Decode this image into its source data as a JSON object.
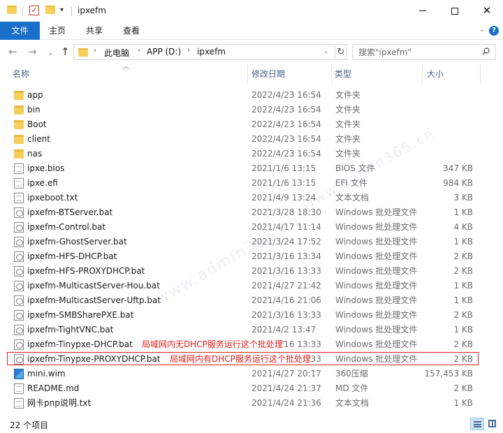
{
  "window": {
    "title": "ipxefm",
    "minimize_icon": "minimize-icon",
    "maximize_icon": "maximize-icon",
    "close_glyph": "✕"
  },
  "ribbon": {
    "tabs": [
      {
        "label": "文件"
      },
      {
        "label": "主页"
      },
      {
        "label": "共享"
      },
      {
        "label": "查看"
      }
    ],
    "accent": "#1a6fc9"
  },
  "navigation": {
    "back_glyph": "←",
    "forward_glyph": "→",
    "recent_glyph": "⌄",
    "up_glyph": "↑",
    "breadcrumbs": [
      "此电脑",
      "APP (D:)",
      "ipxefm"
    ],
    "search_placeholder": "搜索\"ipxefm\""
  },
  "columns": {
    "name": "名称",
    "date": "修改日期",
    "type": "类型",
    "size": "大小"
  },
  "files": [
    {
      "name": "app",
      "date": "2022/4/23 16:54",
      "type": "文件夹",
      "size": "",
      "icon": "folder-icon"
    },
    {
      "name": "bin",
      "date": "2022/4/23 16:54",
      "type": "文件夹",
      "size": "",
      "icon": "folder-icon"
    },
    {
      "name": "Boot",
      "date": "2022/4/23 16:54",
      "type": "文件夹",
      "size": "",
      "icon": "folder-icon"
    },
    {
      "name": "client",
      "date": "2022/4/23 16:54",
      "type": "文件夹",
      "size": "",
      "icon": "folder-icon"
    },
    {
      "name": "nas",
      "date": "2022/4/23 16:54",
      "type": "文件夹",
      "size": "",
      "icon": "folder-icon"
    },
    {
      "name": "ipxe.bios",
      "date": "2021/1/6 13:15",
      "type": "BIOS 文件",
      "size": "347 KB",
      "icon": "file-icon"
    },
    {
      "name": "ipxe.efi",
      "date": "2021/1/6 13:15",
      "type": "EFI 文件",
      "size": "984 KB",
      "icon": "file-icon"
    },
    {
      "name": "ipxeboot.txt",
      "date": "2021/4/9 13:24",
      "type": "文本文档",
      "size": "3 KB",
      "icon": "text-file-icon"
    },
    {
      "name": "ipxefm-BTServer.bat",
      "date": "2021/3/28 18:30",
      "type": "Windows 批处理文件",
      "size": "1 KB",
      "icon": "batch-file-icon"
    },
    {
      "name": "ipxefm-Control.bat",
      "date": "2021/4/17 11:14",
      "type": "Windows 批处理文件",
      "size": "4 KB",
      "icon": "batch-file-icon"
    },
    {
      "name": "ipxefm-GhostServer.bat",
      "date": "2021/3/24 17:52",
      "type": "Windows 批处理文件",
      "size": "1 KB",
      "icon": "batch-file-icon"
    },
    {
      "name": "ipxefm-HFS-DHCP.bat",
      "date": "2021/3/16 13:34",
      "type": "Windows 批处理文件",
      "size": "2 KB",
      "icon": "batch-file-icon"
    },
    {
      "name": "ipxefm-HFS-PROXYDHCP.bat",
      "date": "2021/3/16 13:33",
      "type": "Windows 批处理文件",
      "size": "2 KB",
      "icon": "batch-file-icon"
    },
    {
      "name": "ipxefm-MulticastServer-Hou.bat",
      "date": "2021/4/27 21:42",
      "type": "Windows 批处理文件",
      "size": "1 KB",
      "icon": "batch-file-icon"
    },
    {
      "name": "ipxefm-MulticastServer-Uftp.bat",
      "date": "2021/4/16 21:06",
      "type": "Windows 批处理文件",
      "size": "1 KB",
      "icon": "batch-file-icon"
    },
    {
      "name": "ipxefm-SMBSharePXE.bat",
      "date": "2021/3/16 13:33",
      "type": "Windows 批处理文件",
      "size": "2 KB",
      "icon": "batch-file-icon"
    },
    {
      "name": "ipxefm-TightVNC.bat",
      "date": "2021/4/2 13:47",
      "type": "Windows 批处理文件",
      "size": "1 KB",
      "icon": "batch-file-icon"
    },
    {
      "name": "ipxefm-Tinypxe-DHCP.bat",
      "date": "2021/3/16 13:33",
      "type": "Windows 批处理文件",
      "size": "2 KB",
      "icon": "batch-file-icon"
    },
    {
      "name": "ipxefm-Tinypxe-PROXYDHCP.bat",
      "date": "2021/3/16 13:33",
      "type": "Windows 批处理文件",
      "size": "2 KB",
      "icon": "batch-file-icon"
    },
    {
      "name": "mini.wim",
      "date": "2021/4/27 20:17",
      "type": "360压缩",
      "size": "157,453 KB",
      "icon": "archive-icon"
    },
    {
      "name": "README.md",
      "date": "2021/4/24 21:37",
      "type": "MD 文件",
      "size": "2 KB",
      "icon": "file-icon"
    },
    {
      "name": "网卡pnp说明.txt",
      "date": "2021/4/24 21:36",
      "type": "文本文档",
      "size": "1 KB",
      "icon": "text-file-icon"
    }
  ],
  "annotations": {
    "no_dhcp": "局域网内无DHCP服务运行这个批处理",
    "has_dhcp": "局域网内有DHCP服务运行这个批处理",
    "color": "#e02020"
  },
  "status": {
    "item_count": "22 个项目"
  },
  "watermark": {
    "text": "www.admin365.cn"
  }
}
